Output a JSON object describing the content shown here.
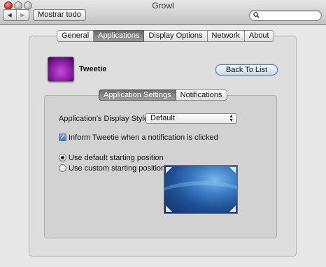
{
  "window": {
    "title": "Growl"
  },
  "toolbar": {
    "back_icon": "back-arrow-icon",
    "forward_icon": "forward-arrow-icon",
    "back_glyph": "◀",
    "forward_glyph": "▶",
    "show_all_label": "Mostrar todo",
    "search": {
      "value": "",
      "placeholder": ""
    }
  },
  "tabs_top": [
    {
      "label": "General",
      "active": false
    },
    {
      "label": "Applications",
      "active": true
    },
    {
      "label": "Display Options",
      "active": false
    },
    {
      "label": "Network",
      "active": false
    },
    {
      "label": "About",
      "active": false
    }
  ],
  "app": {
    "name": "Tweetie",
    "icon": "tweetie-app-icon",
    "back_button_label": "Back To List"
  },
  "tabs_inner": [
    {
      "label": "Application Settings",
      "active": true
    },
    {
      "label": "Notifications",
      "active": false
    }
  ],
  "settings": {
    "display_style_label": "Application's Display Style:",
    "display_style_value": "Default",
    "inform_checkbox_label": "Inform Tweetie when a notification is clicked",
    "inform_checked": true,
    "radio_default_label": "Use default starting position",
    "radio_custom_label": "Use custom starting position:",
    "selected_position": "default"
  },
  "colors": {
    "accent_blue": "#3a74c4",
    "active_tab": "#7a7a7a",
    "window_bg": "#e8e8e8"
  }
}
